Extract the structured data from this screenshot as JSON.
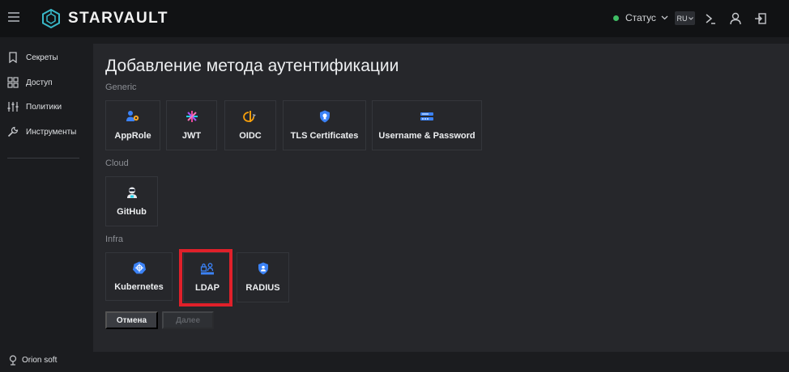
{
  "app": {
    "name": "STARVAULT",
    "status_label": "Статус",
    "language": "RU"
  },
  "colors": {
    "accent_teal": "#39b8c8",
    "status_green": "#3fbd64",
    "highlight_red": "#e0202a"
  },
  "sidebar": {
    "items": [
      {
        "label": "Секреты",
        "icon": "bookmark-icon"
      },
      {
        "label": "Доступ",
        "icon": "grid-icon"
      },
      {
        "label": "Политики",
        "icon": "sliders-icon"
      },
      {
        "label": "Инструменты",
        "icon": "wrench-icon"
      }
    ],
    "footer": "Orion soft"
  },
  "page": {
    "title": "Добавление метода аутентификации",
    "sections": {
      "generic": {
        "label": "Generic",
        "methods": [
          "AppRole",
          "JWT",
          "OIDC",
          "TLS Certificates",
          "Username & Password"
        ]
      },
      "cloud": {
        "label": "Cloud",
        "methods": [
          "GitHub"
        ]
      },
      "infra": {
        "label": "Infra",
        "methods": [
          "Kubernetes",
          "LDAP",
          "RADIUS"
        ]
      }
    },
    "buttons": {
      "cancel": "Отмена",
      "next": "Далее"
    }
  }
}
